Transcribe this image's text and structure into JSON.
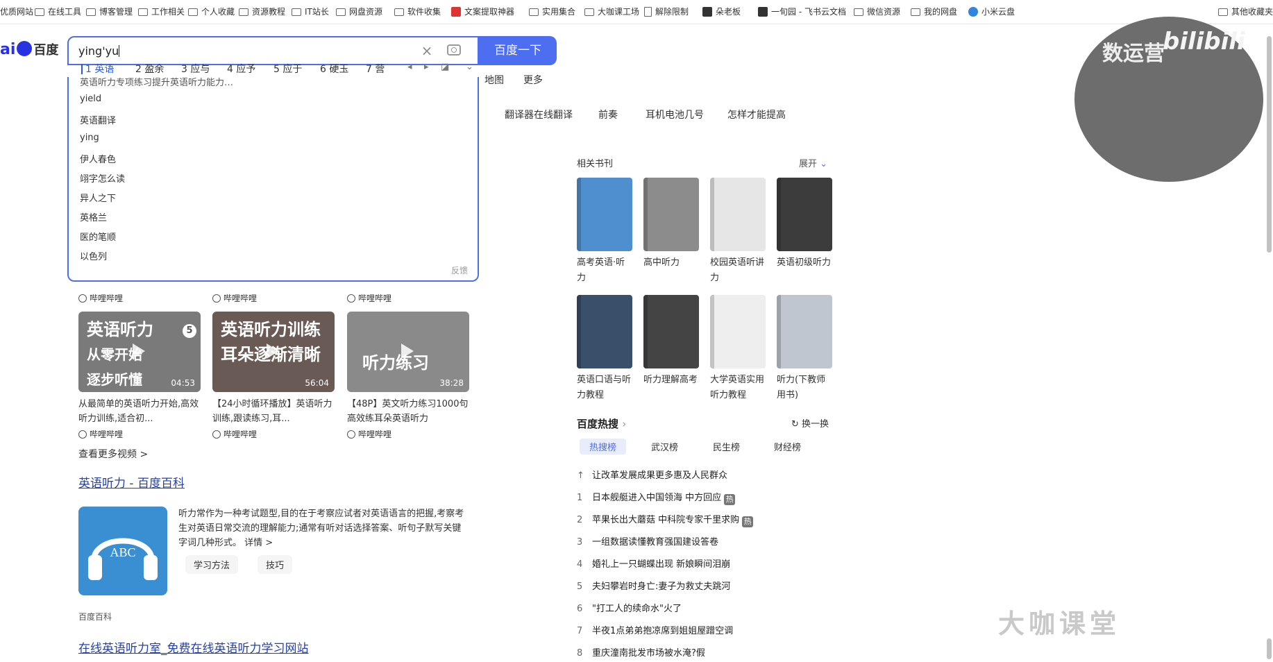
{
  "bookmarks": [
    {
      "label": "优质网站",
      "icon": "folder"
    },
    {
      "label": "在线工具",
      "icon": "folder"
    },
    {
      "label": "博客管理",
      "icon": "folder"
    },
    {
      "label": "工作相关",
      "icon": "folder"
    },
    {
      "label": "个人收藏",
      "icon": "folder"
    },
    {
      "label": "资源教程",
      "icon": "folder"
    },
    {
      "label": "IT站长",
      "icon": "folder"
    },
    {
      "label": "网盘资源",
      "icon": "folder"
    },
    {
      "label": "软件收集",
      "icon": "folder"
    },
    {
      "label": "文案提取神器",
      "icon": "red-app"
    },
    {
      "label": "实用集合",
      "icon": "folder"
    },
    {
      "label": "大咖课工场",
      "icon": "folder"
    },
    {
      "label": "解除限制",
      "icon": "page"
    },
    {
      "label": "朵老板",
      "icon": "dark-app"
    },
    {
      "label": "一旬园 - 飞书云文档",
      "icon": "dark-app"
    },
    {
      "label": "微信资源",
      "icon": "folder"
    },
    {
      "label": "我的网盘",
      "icon": "folder"
    },
    {
      "label": "小米云盘",
      "icon": "cloud"
    },
    {
      "label": "其他收藏夹",
      "icon": "folder"
    }
  ],
  "logo": {
    "text_latin": "ai",
    "text_cn": "百度"
  },
  "search": {
    "value": "ying'yu",
    "button": "百度一下"
  },
  "ime": {
    "candidates": [
      "1 英语",
      "2 盈余",
      "3 应与",
      "4 应予",
      "5 应于",
      "6 硬玉",
      "7 营"
    ],
    "icons": [
      "prev-page-icon",
      "next-page-icon",
      "skin-icon",
      "expand-icon"
    ]
  },
  "suggestions": {
    "partial": "英语听力专项练习提升英语听力能力…",
    "items": [
      "yield",
      "英语翻译",
      "ying",
      "伊人春色",
      "翊字怎么读",
      "异人之下",
      "英格兰",
      "医的笔顺",
      "以色列"
    ],
    "feedback": "反馈"
  },
  "nav": {
    "map": "地图",
    "more": "更多"
  },
  "related_searches": [
    "翻译器在线翻译",
    "前奏",
    "耳机电池几号",
    "怎样才能提高"
  ],
  "videos": {
    "source": "哔哩哔哩",
    "items": [
      {
        "thumb_lines": [
          "英语听力",
          "从零开始",
          "逐步听懂"
        ],
        "badge": "5",
        "duration": "04:53",
        "title": "从最简单的英语听力开始,高效听力训练,适合初...",
        "thumb_color": "#7a7a7a"
      },
      {
        "thumb_lines": [
          "英语听力训练",
          "耳朵逐渐清晰"
        ],
        "badge": "",
        "duration": "56:04",
        "title": "【24小时循环播放】英语听力训练,跟读练习,耳...",
        "thumb_color": "#6a5a55"
      },
      {
        "thumb_lines": [
          "听力练习"
        ],
        "badge": "",
        "duration": "38:28",
        "title": "【48P】英文听力练习1000句高效练耳朵英语听力",
        "thumb_color": "#8a8a8a"
      }
    ],
    "more": "查看更多视频 >"
  },
  "baike": {
    "title": "英语听力 - 百度百科",
    "image_text": "ABC",
    "summary": "听力常作为一种考试题型,目的在于考察应试者对英语语言的把握,考察考生对英语日常交流的理解能力;通常有听对话选择答案、听句子默写关键字词几种形式。",
    "detail": "详情 >",
    "pills": [
      "学习方法",
      "技巧"
    ],
    "source": "百度百科"
  },
  "next_result": {
    "title": "在线英语听力室_免费在线英语听力学习网站"
  },
  "books": {
    "heading": "相关书刊",
    "expand": "展开",
    "items": [
      {
        "title": "高考英语·听力",
        "color": "#4f8fd0"
      },
      {
        "title": "高中听力",
        "color": "#8c8c8c"
      },
      {
        "title": "校园英语听讲力",
        "color": "#e6e6e6"
      },
      {
        "title": "英语初级听力",
        "color": "#3c3c3c"
      },
      {
        "title": "英语口语与听力教程",
        "color": "#3a4f6a"
      },
      {
        "title": "听力理解高考",
        "color": "#444444"
      },
      {
        "title": "大学英语实用听力教程",
        "color": "#eeeeee"
      },
      {
        "title": "听力(下教师用书)",
        "color": "#bfc6cf"
      }
    ]
  },
  "hot": {
    "heading": "百度热搜",
    "refresh": "换一换",
    "tabs": [
      "热搜榜",
      "武汉榜",
      "民生榜",
      "财经榜"
    ],
    "items": [
      {
        "rank": "↑",
        "text": "让改革发展成果更多惠及人民群众",
        "badge": ""
      },
      {
        "rank": "1",
        "text": "日本舰艇进入中国领海 中方回应",
        "badge": "热"
      },
      {
        "rank": "2",
        "text": "苹果长出大蘑菇 中科院专家千里求购",
        "badge": "热"
      },
      {
        "rank": "3",
        "text": "一组数据读懂教育强国建设答卷",
        "badge": ""
      },
      {
        "rank": "4",
        "text": "婚礼上一只蝴蝶出现 新娘瞬间泪崩",
        "badge": ""
      },
      {
        "rank": "5",
        "text": "夫妇攀岩时身亡:妻子为救丈夫跳河",
        "badge": ""
      },
      {
        "rank": "6",
        "text": "\"打工人的续命水\"火了",
        "badge": ""
      },
      {
        "rank": "7",
        "text": "半夜1点弟弟抱凉席到姐姐屋蹭空调",
        "badge": ""
      },
      {
        "rank": "8",
        "text": "重庆潼南批发市场被水淹?假",
        "badge": ""
      }
    ]
  },
  "overlay": {
    "webcam_text": "数运营",
    "brand": "bilibili",
    "watermark": "大咖课堂"
  }
}
